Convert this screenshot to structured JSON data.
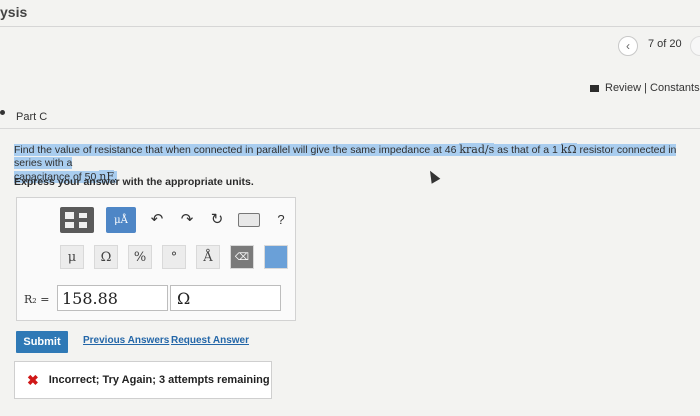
{
  "header": {
    "title": "ysis",
    "pager": {
      "position": "7 of 20"
    },
    "review_link": "Review | Constants"
  },
  "part": {
    "label": "Part C",
    "question": {
      "lead": "Find the value of resistance that when connected in parallel will give the same impedance at 46",
      "freq_unit": "krad/s",
      "mid": "as that of a 1",
      "res_unit": "kΩ",
      "tail": "resistor connected in series with a",
      "cap_text": "capacitance of 50",
      "cap_unit": "nF",
      "period": "."
    },
    "instruction": "Express your answer with the appropriate units."
  },
  "toolbar": {
    "units_label": "μÅ",
    "undo": "↶",
    "redo": "↷",
    "reset": "↻",
    "help": "?",
    "symbols": [
      "μ",
      "Ω",
      "%",
      "°",
      "Å"
    ]
  },
  "answer": {
    "variable_label": "R₂ =",
    "value": "158.88",
    "unit": "Ω"
  },
  "actions": {
    "submit": "Submit",
    "previous_answers": "Previous Answers",
    "request_answer": "Request Answer"
  },
  "feedback": {
    "message": "Incorrect; Try Again; 3 attempts remaining"
  },
  "colors": {
    "accent": "#2f79b6",
    "highlight": "#a9cdef",
    "error": "#d01818"
  }
}
